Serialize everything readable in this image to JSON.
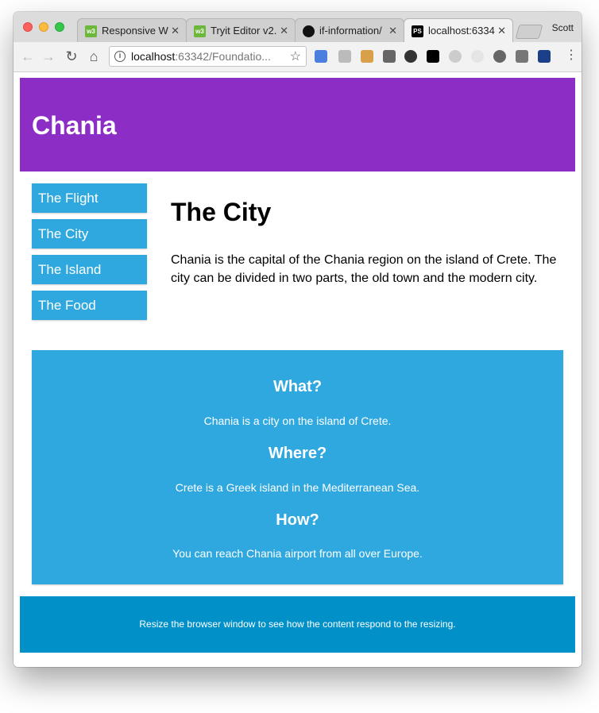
{
  "browser": {
    "tabs": [
      {
        "label": "Responsive We",
        "icon": "w3schools-favicon-icon",
        "active": false
      },
      {
        "label": "Tryit Editor v2.",
        "icon": "w3schools-favicon-icon",
        "active": false
      },
      {
        "label": "if-information/",
        "icon": "github-favicon-icon",
        "active": false
      },
      {
        "label": "localhost:6334",
        "icon": "phpstorm-favicon-icon",
        "active": true
      }
    ],
    "profile_name": "Scott",
    "url_host": "localhost",
    "url_path": ":63342/Foundatio...",
    "colors": {
      "w3": "#6bb83a",
      "github": "#111111",
      "phpstorm": "#000000"
    }
  },
  "page": {
    "header_title": "Chania",
    "menu": [
      "The Flight",
      "The City",
      "The Island",
      "The Food"
    ],
    "main_heading": "The City",
    "main_text": "Chania is the capital of the Chania region on the island of Crete. The city can be divided in two parts, the old town and the modern city.",
    "aside": [
      {
        "heading": "What?",
        "text": "Chania is a city on the island of Crete."
      },
      {
        "heading": "Where?",
        "text": "Crete is a Greek island in the Mediterranean Sea."
      },
      {
        "heading": "How?",
        "text": "You can reach Chania airport from all over Europe."
      }
    ],
    "footer_text": "Resize the browser window to see how the content respond to the resizing.",
    "colors": {
      "header": "#8c2dc6",
      "menu": "#2fa8e0",
      "aside": "#2fa8e0",
      "footer": "#0191c8"
    }
  }
}
